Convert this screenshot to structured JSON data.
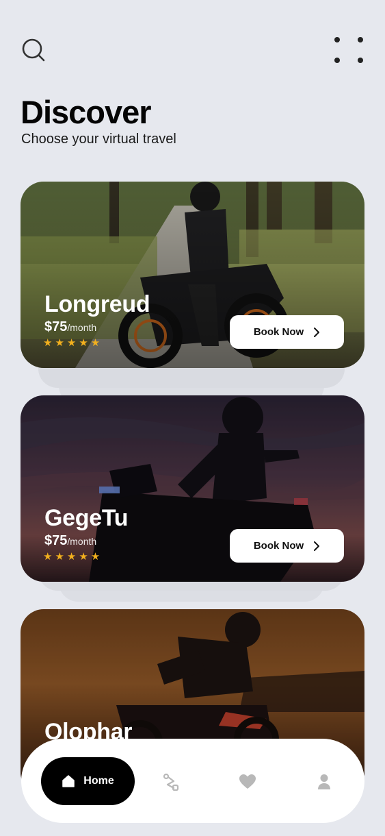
{
  "header": {
    "title": "Discover",
    "subtitle": "Choose your virtual travel",
    "search_icon": "search-icon",
    "menu_icon": "four-dots-menu-icon"
  },
  "cards": [
    {
      "name": "Longreud",
      "price": "$75",
      "period": "/month",
      "stars": "★★★★★",
      "rating": 5,
      "button": "Book Now"
    },
    {
      "name": "GegeTu",
      "price": "$75",
      "period": "/month",
      "stars": "★★★★★",
      "rating": 5,
      "button": "Book Now"
    },
    {
      "name": "Olophar"
    }
  ],
  "nav": {
    "home_label": "Home",
    "items": [
      "home-icon",
      "route-icon",
      "heart-icon",
      "user-icon"
    ]
  },
  "colors": {
    "background": "#e6e8ee",
    "star": "#f2b01e",
    "nav_active": "#000000",
    "nav_inactive_icon": "#b8b8b8"
  }
}
